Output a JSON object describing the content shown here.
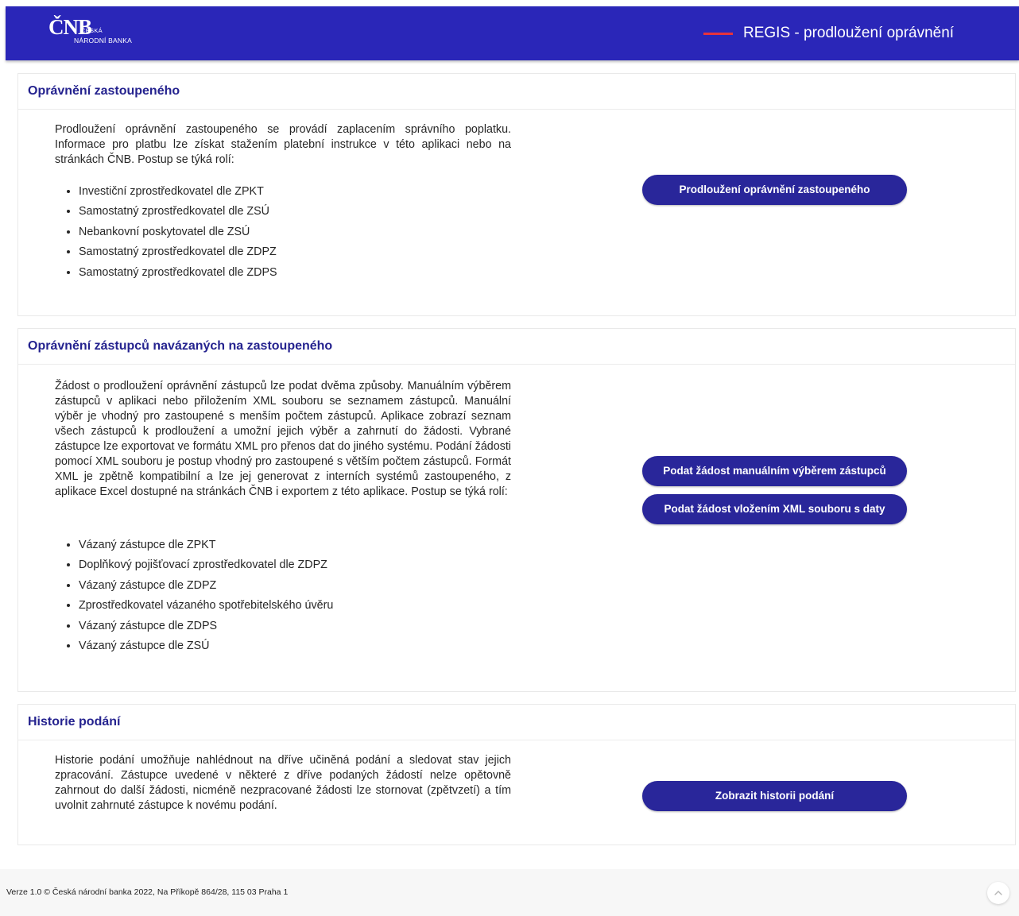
{
  "header": {
    "logo_main": "ČNB",
    "logo_sub1": "ČESKÁ",
    "logo_sub2": "NÁRODNÍ BANKA",
    "title": "REGIS - prodloužení oprávnění",
    "accent_color": "#e8333b",
    "background_color": "#2a26b8"
  },
  "sections": [
    {
      "title": "Oprávnění zastoupeného",
      "text": "Prodloužení oprávnění zastoupeného se provádí zaplacením správního poplatku. Informace pro platbu lze získat stažením platební instrukce v této aplikaci nebo na stránkách ČNB. Postup se týká rolí:",
      "roles": [
        "Investiční zprostředkovatel dle ZPKT",
        "Samostatný zprostředkovatel dle ZSÚ",
        "Nebankovní poskytovatel dle ZSÚ",
        "Samostatný zprostředkovatel dle ZDPZ",
        "Samostatný zprostředkovatel dle ZDPS"
      ],
      "buttons": [
        "Prodloužení oprávnění zastoupeného"
      ]
    },
    {
      "title": "Oprávnění zástupců navázaných na zastoupeného",
      "text": "Žádost o prodloužení oprávnění zástupců lze podat dvěma způsoby. Manuálním výběrem zástupců v aplikaci nebo přiložením XML souboru se seznamem zástupců. Manuální výběr je vhodný pro zastoupené s menším počtem zástupců. Aplikace zobrazí seznam všech zástupců k prodloužení a umožní jejich výběr a zahrnutí do žádosti. Vybrané zástupce lze exportovat ve formátu XML pro přenos dat do jiného systému. Podání žádosti pomocí XML souboru je postup vhodný pro zastoupené s větším počtem zástupců. Formát XML je zpětně kompatibilní a lze jej generovat z interních systémů zastoupeného, z aplikace Excel dostupné na stránkách ČNB i exportem z této aplikace. Postup se týká rolí:",
      "roles": [
        "Vázaný zástupce dle ZPKT",
        "Doplňkový pojišťovací zprostředkovatel dle ZDPZ",
        "Vázaný zástupce dle ZDPZ",
        "Zprostředkovatel vázaného spotřebitelského úvěru",
        "Vázaný zástupce dle ZDPS",
        "Vázaný zástupce dle ZSÚ"
      ],
      "buttons": [
        "Podat žádost manuálním výběrem zástupců",
        "Podat žádost vložením XML souboru s daty"
      ]
    },
    {
      "title": "Historie podání",
      "text": "Historie podání umožňuje nahlédnout na dříve učiněná podání a sledovat stav jejich zpracování. Zástupce uvedené v některé z dříve podaných žádostí nelze opětovně zahrnout do další žádosti, nicméně nezpracované žádosti lze stornovat (zpětvzetí) a tím uvolnit zahrnuté zástupce k novému podání.",
      "buttons": [
        "Zobrazit historii podání"
      ]
    }
  ],
  "footer": {
    "text": "Verze 1.0 © Česká národní banka 2022, Na Příkopě 864/28, 115 03 Praha 1",
    "scroll_top_icon": "chevron-up-icon"
  },
  "colors": {
    "section_title": "#25238f",
    "button": "#29269a"
  }
}
